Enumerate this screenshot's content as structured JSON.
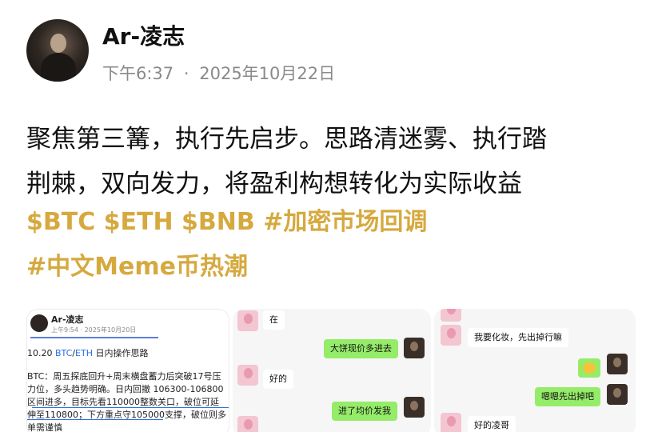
{
  "author": {
    "name": "Ar-凌志",
    "time": "下午6:37",
    "separator": "·",
    "date": "2025年10月22日"
  },
  "post": {
    "line1": "聚焦第三篝，执行先启步。思路清迷雾、执行踏",
    "line2": "荆棘，双向发力，将盈利构想转化为实际收益",
    "tags_line1": "$BTC $ETH $BNB #加密市场回调",
    "tags_line2": "#中文Meme币热潮"
  },
  "colors": {
    "tag": "#d6a93f",
    "chat_bubble_green": "#95ec69",
    "link_blue": "#2b6de0"
  },
  "image1": {
    "name": "Ar-凌志",
    "meta": "上午9:54 · 2025年10月20日",
    "title_prefix": "10.20 ",
    "title_btc": "BTC",
    "title_slash": "/",
    "title_eth": "ETH",
    "title_suffix": " 日内操作思路",
    "body": "BTC：周五探底回升+周末横盘蓄力后突破17号压力位，多头趋势明确。日内回撤 106300-106800区间进多，目标先看110000整数关口，破位可延伸至110800；下方重点守105000支撑，破位则多单需谨慎"
  },
  "image2": {
    "messages": [
      "在",
      "大饼现价多进去",
      "好的",
      "进了均价发我"
    ]
  },
  "image3": {
    "messages": [
      "我要化妆，先出掉行嘛",
      "嗯嗯先出掉吧",
      "好的凌哥"
    ]
  }
}
